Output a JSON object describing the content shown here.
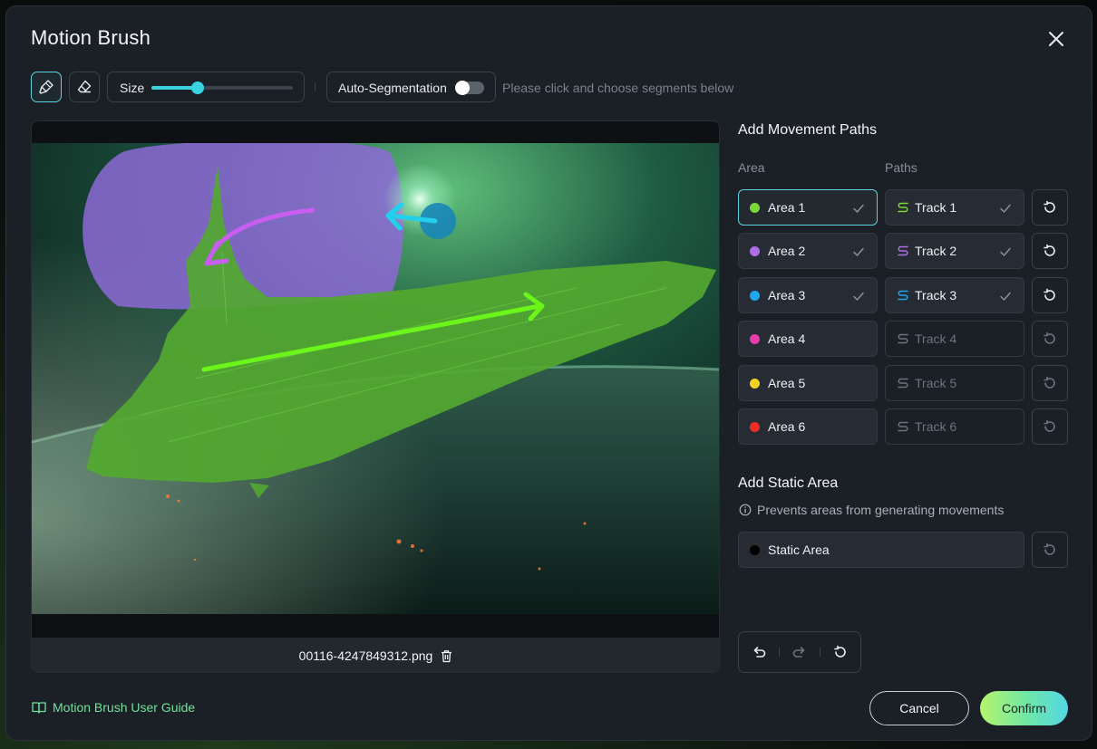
{
  "dialog": {
    "title": "Motion Brush",
    "close_icon": "close-icon"
  },
  "toolbar": {
    "brush_icon": "brush-icon",
    "eraser_icon": "eraser-icon",
    "size_label": "Size",
    "size_value_fraction": 0.33,
    "autoseg_label": "Auto-Segmentation",
    "autoseg_on": false,
    "hint": "Please click and choose segments below"
  },
  "canvas": {
    "filename": "00116-4247849312.png",
    "delete_icon": "trash-icon"
  },
  "movement": {
    "heading": "Add Movement Paths",
    "col_area": "Area",
    "col_paths": "Paths",
    "rows": [
      {
        "area": "Area 1",
        "color": "#7ad73a",
        "track": "Track 1",
        "track_color": "#7ad73a",
        "done": true,
        "selected": true
      },
      {
        "area": "Area 2",
        "color": "#b06de8",
        "track": "Track 2",
        "track_color": "#b06de8",
        "done": true,
        "selected": false
      },
      {
        "area": "Area 3",
        "color": "#1ea6ef",
        "track": "Track 3",
        "track_color": "#1ea6ef",
        "done": true,
        "selected": false
      },
      {
        "area": "Area 4",
        "color": "#e83ca8",
        "track": "Track 4",
        "track_color": "#6d747e",
        "done": false,
        "selected": false
      },
      {
        "area": "Area 5",
        "color": "#f4d222",
        "track": "Track 5",
        "track_color": "#6d747e",
        "done": false,
        "selected": false
      },
      {
        "area": "Area 6",
        "color": "#ee2e24",
        "track": "Track 6",
        "track_color": "#6d747e",
        "done": false,
        "selected": false
      }
    ]
  },
  "static": {
    "heading": "Add Static Area",
    "info": "Prevents areas from generating movements",
    "label": "Static Area",
    "color": "#000000"
  },
  "history": {
    "undo_icon": "undo-icon",
    "redo_icon": "redo-icon",
    "reset_icon": "reset-icon"
  },
  "footer": {
    "guide_label": "Motion Brush User Guide",
    "cancel_label": "Cancel",
    "confirm_label": "Confirm"
  }
}
